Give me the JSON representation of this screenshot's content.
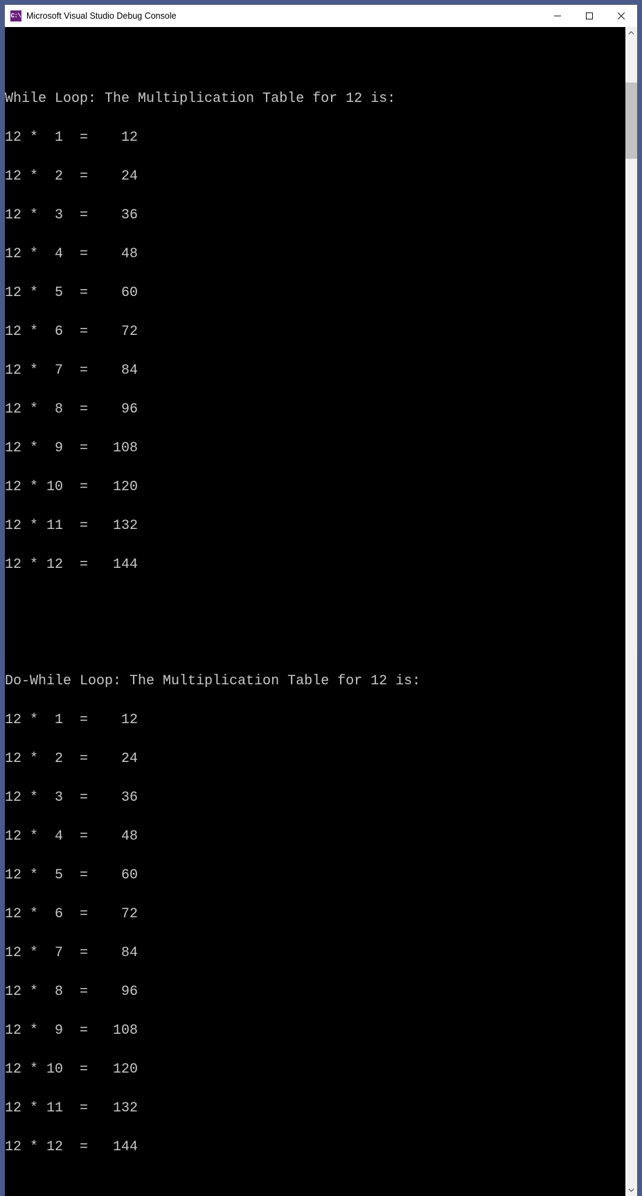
{
  "window": {
    "icon_text": "C:\\",
    "title": "Microsoft Visual Studio Debug Console"
  },
  "console": {
    "section1_header": "While Loop: The Multiplication Table for 12 is:",
    "section1_rows": [
      "12 *  1  =    12",
      "12 *  2  =    24",
      "12 *  3  =    36",
      "12 *  4  =    48",
      "12 *  5  =    60",
      "12 *  6  =    72",
      "12 *  7  =    84",
      "12 *  8  =    96",
      "12 *  9  =   108",
      "12 * 10  =   120",
      "12 * 11  =   132",
      "12 * 12  =   144"
    ],
    "section2_header": "Do-While Loop: The Multiplication Table for 12 is:",
    "section2_rows": [
      "12 *  1  =    12",
      "12 *  2  =    24",
      "12 *  3  =    36",
      "12 *  4  =    48",
      "12 *  5  =    60",
      "12 *  6  =    72",
      "12 *  7  =    84",
      "12 *  8  =    96",
      "12 *  9  =   108",
      "12 * 10  =   120",
      "12 * 11  =   132",
      "12 * 12  =   144"
    ]
  },
  "chart_data": {
    "type": "table",
    "title": "Multiplication Table for 12",
    "series": [
      {
        "name": "While Loop",
        "multiplicand": 12,
        "multipliers": [
          1,
          2,
          3,
          4,
          5,
          6,
          7,
          8,
          9,
          10,
          11,
          12
        ],
        "products": [
          12,
          24,
          36,
          48,
          60,
          72,
          84,
          96,
          108,
          120,
          132,
          144
        ]
      },
      {
        "name": "Do-While Loop",
        "multiplicand": 12,
        "multipliers": [
          1,
          2,
          3,
          4,
          5,
          6,
          7,
          8,
          9,
          10,
          11,
          12
        ],
        "products": [
          12,
          24,
          36,
          48,
          60,
          72,
          84,
          96,
          108,
          120,
          132,
          144
        ]
      }
    ]
  }
}
